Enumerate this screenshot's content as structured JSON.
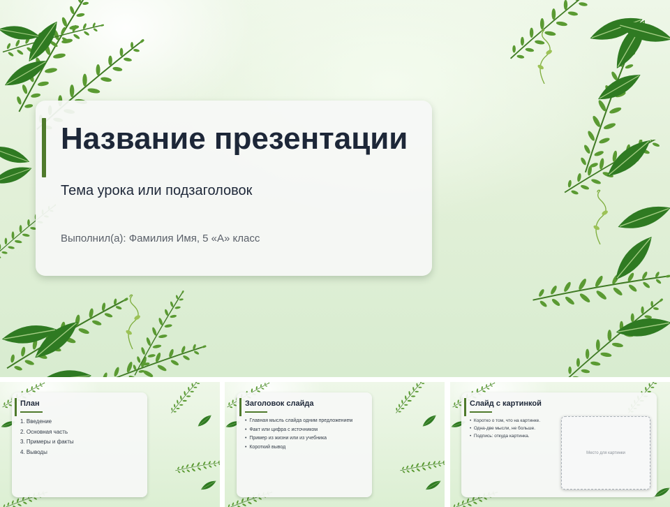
{
  "main_slide": {
    "title": "Название презентации",
    "subtitle": "Тема урока или подзаголовок",
    "author": "Выполнил(а): Фамилия Имя, 5 «А» класс"
  },
  "thumbnails": [
    {
      "title": "План",
      "items": [
        "1. Введение",
        "2. Основная часть",
        "3. Примеры и факты",
        "4. Выводы"
      ]
    },
    {
      "title": "Заголовок слайда",
      "items": [
        "Главная мысль слайда одним предложением",
        "Факт или цифра с источником",
        "Пример из жизни или из учебника",
        "Короткий вывод"
      ]
    },
    {
      "title": "Слайд с картинкой",
      "items": [
        "Коротко о том, что на картинке.",
        "Одна-две мысли, не больше.",
        "Подпись: откуда картинка."
      ],
      "placeholder": "Место для картинки"
    }
  ],
  "colors": {
    "accent": "#4f7a2c",
    "title_text": "#1d2738",
    "background": "#e2f0d8"
  }
}
